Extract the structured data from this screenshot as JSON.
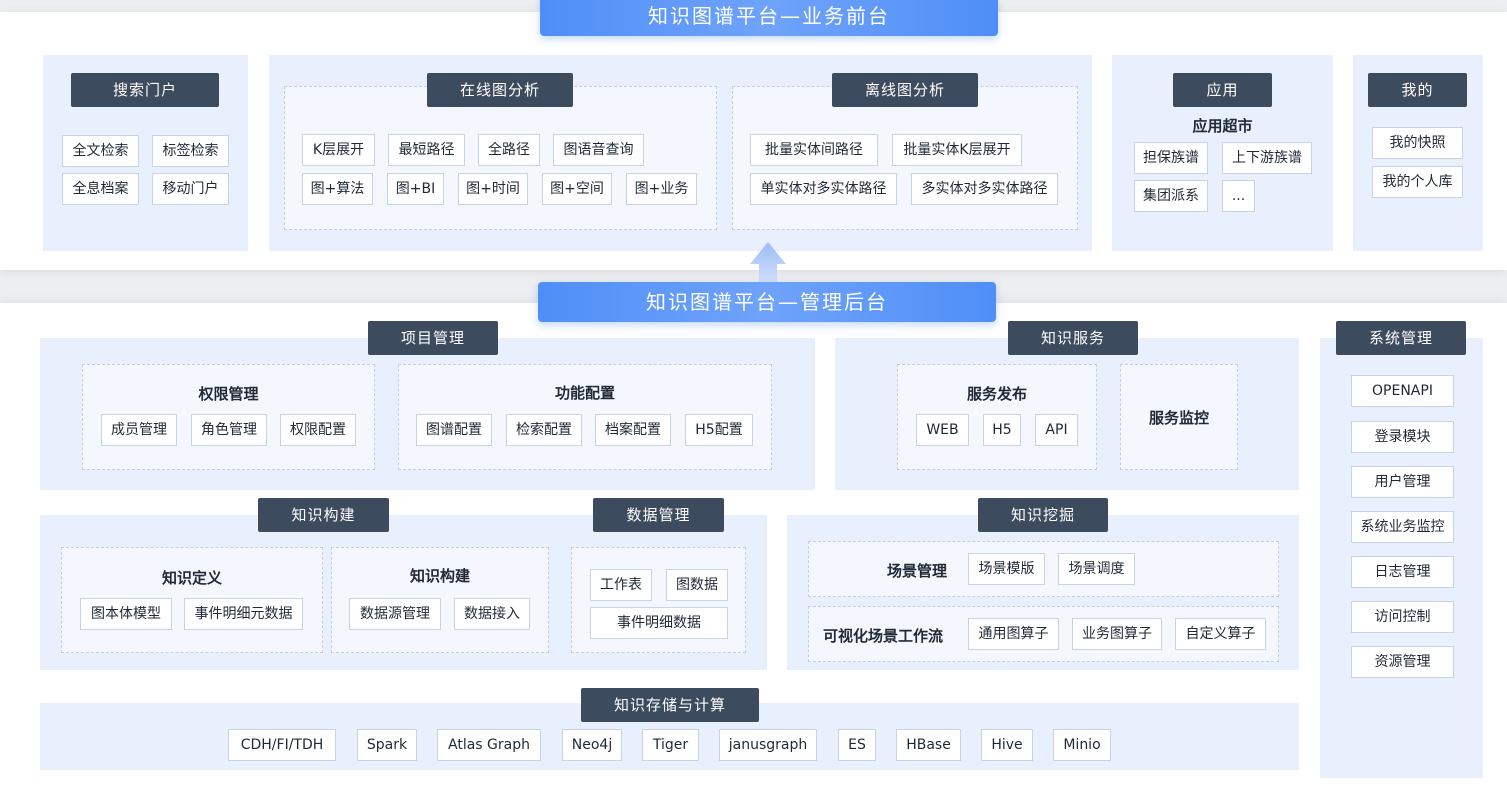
{
  "front": {
    "title": "知识图谱平台—业务前台",
    "search": {
      "header": "搜索门户",
      "items": [
        "全文检索",
        "标签检索",
        "全息档案",
        "移动门户"
      ]
    },
    "online": {
      "header": "在线图分析",
      "items": [
        "K层展开",
        "最短路径",
        "全路径",
        "图语音查询",
        "图+算法",
        "图+BI",
        "图+时间",
        "图+空间",
        "图+业务"
      ]
    },
    "offline": {
      "header": "离线图分析",
      "items": [
        "批量实体间路径",
        "批量实体K层展开",
        "单实体对多实体路径",
        "多实体对多实体路径"
      ]
    },
    "apps": {
      "header": "应用",
      "subtitle": "应用超市",
      "items": [
        "担保族谱",
        "上下游族谱",
        "集团派系",
        "..."
      ]
    },
    "mine": {
      "header": "我的",
      "items": [
        "我的快照",
        "我的个人库"
      ]
    }
  },
  "back": {
    "title": "知识图谱平台—管理后台",
    "project": {
      "header": "项目管理",
      "perm": {
        "title": "权限管理",
        "items": [
          "成员管理",
          "角色管理",
          "权限配置"
        ]
      },
      "func": {
        "title": "功能配置",
        "items": [
          "图谱配置",
          "检索配置",
          "档案配置",
          "H5配置"
        ]
      }
    },
    "service": {
      "header": "知识服务",
      "publish": {
        "title": "服务发布",
        "items": [
          "WEB",
          "H5",
          "API"
        ]
      },
      "monitor": "服务监控"
    },
    "system": {
      "header": "系统管理",
      "items": [
        "OPENAPI",
        "登录模块",
        "用户管理",
        "系统业务监控",
        "日志管理",
        "访问控制",
        "资源管理"
      ]
    },
    "build": {
      "header": "知识构建",
      "define": {
        "title": "知识定义",
        "items": [
          "图本体模型",
          "事件明细元数据"
        ]
      },
      "construct": {
        "title": "知识构建",
        "items": [
          "数据源管理",
          "数据接入"
        ]
      }
    },
    "data": {
      "header": "数据管理",
      "items": [
        "工作表",
        "图数据",
        "事件明细数据"
      ]
    },
    "mining": {
      "header": "知识挖掘",
      "scene": {
        "title": "场景管理",
        "items": [
          "场景模版",
          "场景调度"
        ]
      },
      "flow": {
        "title": "可视化场景工作流",
        "items": [
          "通用图算子",
          "业务图算子",
          "自定义算子"
        ]
      }
    },
    "storage": {
      "header": "知识存储与计算",
      "items": [
        "CDH/FI/TDH",
        "Spark",
        "Atlas Graph",
        "Neo4j",
        "Tiger",
        "janusgraph",
        "ES",
        "HBase",
        "Hive",
        "Minio"
      ]
    }
  },
  "colors": {
    "accent": "#4f8ef7",
    "header_bg": "#3d4b5f",
    "panel_bg": "#e8f0fd"
  },
  "icons": {
    "arrow": "up-arrow-icon"
  }
}
